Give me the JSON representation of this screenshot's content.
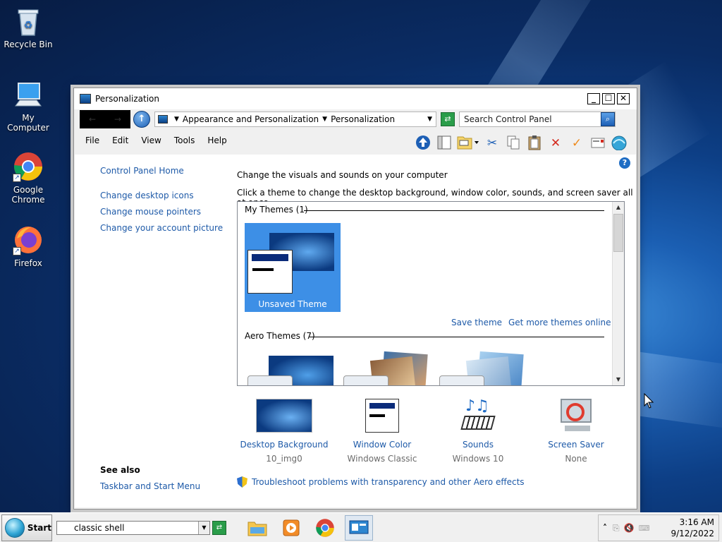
{
  "desktop": {
    "icons": [
      {
        "label": "Recycle Bin",
        "icon": "recycle-bin-icon"
      },
      {
        "label": "My Computer",
        "icon": "computer-icon"
      },
      {
        "label": "Google Chrome",
        "icon": "chrome-icon"
      },
      {
        "label": "Firefox",
        "icon": "firefox-icon"
      }
    ]
  },
  "window": {
    "title": "Personalization",
    "controls": {
      "minimize": "_",
      "maximize": "☐",
      "close": "✕"
    },
    "address": {
      "crumbs": [
        "Appearance and Personalization",
        "Personalization"
      ],
      "search_placeholder": "Search Control Panel"
    },
    "menu": [
      "File",
      "Edit",
      "View",
      "Tools",
      "Help"
    ],
    "toolbar_icons": [
      "up-icon",
      "panes-icon",
      "folder-icon",
      "cut-icon",
      "copy-icon",
      "paste-icon",
      "delete-icon",
      "checkmark-icon",
      "properties-icon",
      "shell-icon"
    ],
    "sidebar": {
      "home": "Control Panel Home",
      "links": [
        "Change desktop icons",
        "Change mouse pointers",
        "Change your account picture"
      ],
      "see_also_title": "See also",
      "see_also_links": [
        "Taskbar and Start Menu"
      ]
    },
    "main": {
      "heading": "Change the visuals and sounds on your computer",
      "subheading": "Click a theme to change the desktop background, window color, sounds, and screen saver all at once.",
      "my_themes_title": "My Themes (1)",
      "my_themes": [
        {
          "name": "Unsaved Theme"
        }
      ],
      "save_theme": "Save theme",
      "get_more_themes": "Get more themes online",
      "aero_themes_title": "Aero Themes (7)"
    },
    "options": [
      {
        "label": "Desktop Background",
        "sub": "10_img0",
        "icon": "wallpaper-icon"
      },
      {
        "label": "Window Color",
        "sub": "Windows Classic",
        "icon": "window-color-icon"
      },
      {
        "label": "Sounds",
        "sub": "Windows 10",
        "icon": "sounds-icon"
      },
      {
        "label": "Screen Saver",
        "sub": "None",
        "icon": "screen-saver-icon"
      }
    ],
    "troubleshoot_link": "Troubleshoot problems with transparency and other Aero effects"
  },
  "taskbar": {
    "start_label": "Start",
    "search_value": "classic shell",
    "apps": [
      "file-explorer-icon",
      "media-player-icon",
      "chrome-icon",
      "control-panel-icon"
    ],
    "clock": {
      "time": "3:16 AM",
      "date": "9/12/2022"
    }
  }
}
